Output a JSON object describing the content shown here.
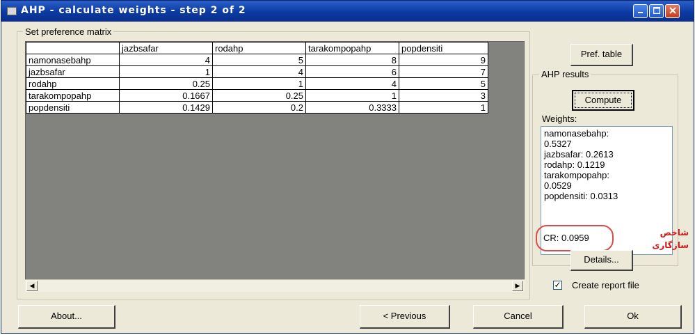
{
  "window": {
    "title": "AHP - calculate weights - step 2 of 2"
  },
  "matrix_group": {
    "label": "Set preference matrix",
    "columns": [
      "",
      "jazbsafar",
      "rodahp",
      "tarakompopahp",
      "popdensiti"
    ],
    "rows": [
      {
        "name": "namonasebahp",
        "values": [
          "4",
          "5",
          "8",
          "9"
        ]
      },
      {
        "name": "jazbsafar",
        "values": [
          "1",
          "4",
          "6",
          "7"
        ]
      },
      {
        "name": "rodahp",
        "values": [
          "0.25",
          "1",
          "4",
          "5"
        ]
      },
      {
        "name": "tarakompopahp",
        "values": [
          "0.1667",
          "0.25",
          "1",
          "3"
        ]
      },
      {
        "name": "popdensiti",
        "values": [
          "0.1429",
          "0.2",
          "0.3333",
          "1"
        ]
      }
    ]
  },
  "side": {
    "pref_table_button": "Pref. table",
    "results_group_label": "AHP results",
    "compute_button": "Compute",
    "weights_label": "Weights:",
    "weights_lines": [
      "namonasebahp:",
      "0.5327",
      "jazbsafar: 0.2613",
      "rodahp: 0.1219",
      "tarakompopahp:",
      "0.0529",
      "popdensiti: 0.0313"
    ],
    "cr_text": "CR: 0.0959",
    "annotation_line1": "شاخص",
    "annotation_line2": "سازگاری",
    "details_button": "Details...",
    "create_report_label": "Create report file",
    "create_report_checked": true
  },
  "footer": {
    "about_button": "About...",
    "previous_button": "< Previous",
    "cancel_button": "Cancel",
    "ok_button": "Ok"
  },
  "colors": {
    "titlebar": "#0b3aa2",
    "grid_background": "#82827f",
    "cr_highlight": "#d94c4c",
    "annotation_text": "#d11a1a"
  }
}
